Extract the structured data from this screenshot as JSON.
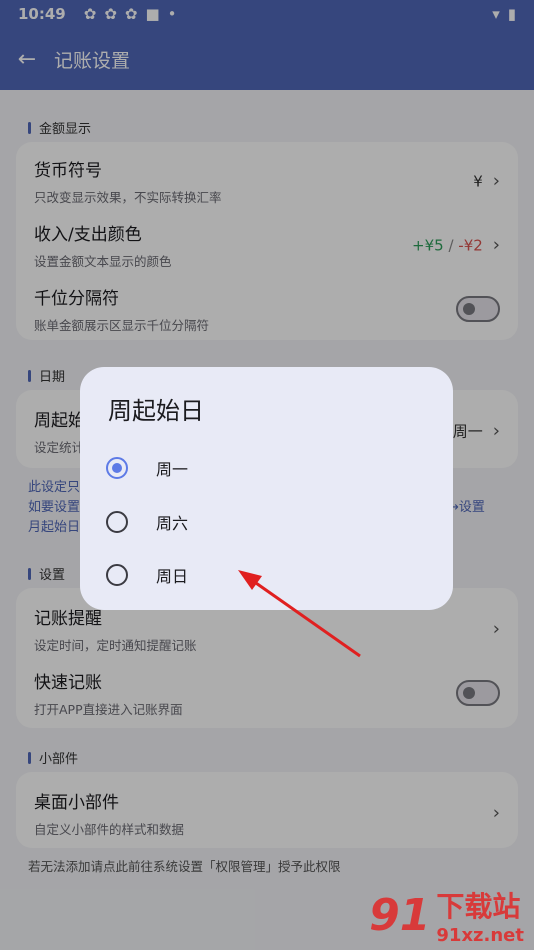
{
  "status_bar": {
    "time": "10:49"
  },
  "app_bar": {
    "title": "记账设置"
  },
  "sections": {
    "amount": {
      "title": "金额显示",
      "currency": {
        "label": "货币符号",
        "sub": "只改变显示效果，不实际转换汇率",
        "value": "¥"
      },
      "color": {
        "label": "收入/支出颜色",
        "sub": "设置金额文本显示的颜色",
        "income": "+¥5",
        "sep": "/",
        "expense": "-¥2"
      },
      "thousands": {
        "label": "千位分隔符",
        "sub": "账单金额展示区显示千位分隔符"
      }
    },
    "date": {
      "title": "日期",
      "week_start": {
        "label": "周起始日",
        "sub": "设定统计",
        "value": "周一"
      },
      "note_lines": [
        "此设定只",
        "如要设置",
        "月起始日"
      ],
      "note_right": "→设置"
    },
    "settings": {
      "title": "设置",
      "reminder": {
        "label": "记账提醒",
        "sub": "设定时间，定时通知提醒记账"
      },
      "quick": {
        "label": "快速记账",
        "sub": "打开APP直接进入记账界面"
      }
    },
    "widget": {
      "title": "小部件",
      "desktop": {
        "label": "桌面小部件",
        "sub": "自定义小部件的样式和数据"
      }
    }
  },
  "hint": "若无法添加请点此前往系统设置「权限管理」授予此权限",
  "dialog": {
    "title": "周起始日",
    "options": [
      "周一",
      "周六",
      "周日"
    ],
    "selected": "周一"
  },
  "colors": {
    "primary": "#5067b8",
    "income": "#2e9e5b",
    "expense": "#d9534f",
    "arrow": "#e02020"
  },
  "watermark": {
    "logo": "91",
    "name": "下载站",
    "url": "91xz.net"
  }
}
